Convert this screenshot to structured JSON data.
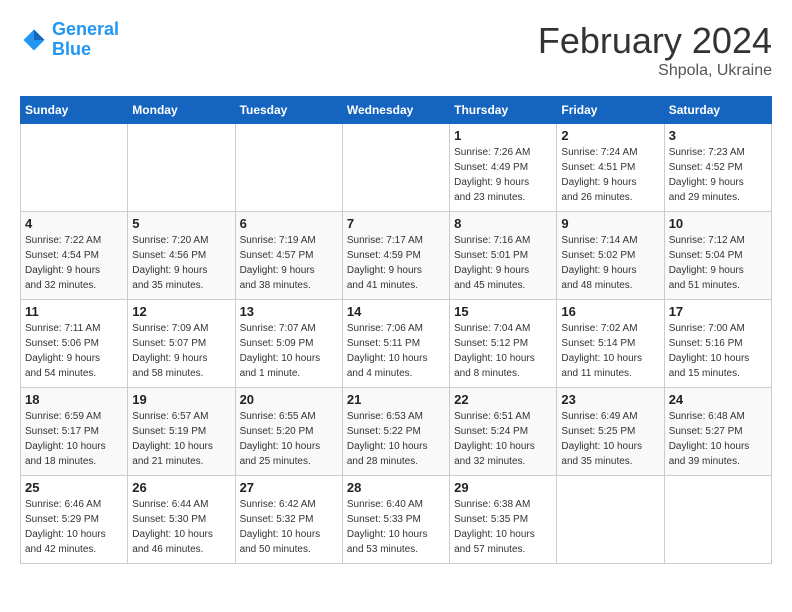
{
  "header": {
    "logo_line1": "General",
    "logo_line2": "Blue",
    "month_year": "February 2024",
    "location": "Shpola, Ukraine"
  },
  "days_of_week": [
    "Sunday",
    "Monday",
    "Tuesday",
    "Wednesday",
    "Thursday",
    "Friday",
    "Saturday"
  ],
  "weeks": [
    [
      {
        "day": "",
        "info": ""
      },
      {
        "day": "",
        "info": ""
      },
      {
        "day": "",
        "info": ""
      },
      {
        "day": "",
        "info": ""
      },
      {
        "day": "1",
        "info": "Sunrise: 7:26 AM\nSunset: 4:49 PM\nDaylight: 9 hours\nand 23 minutes."
      },
      {
        "day": "2",
        "info": "Sunrise: 7:24 AM\nSunset: 4:51 PM\nDaylight: 9 hours\nand 26 minutes."
      },
      {
        "day": "3",
        "info": "Sunrise: 7:23 AM\nSunset: 4:52 PM\nDaylight: 9 hours\nand 29 minutes."
      }
    ],
    [
      {
        "day": "4",
        "info": "Sunrise: 7:22 AM\nSunset: 4:54 PM\nDaylight: 9 hours\nand 32 minutes."
      },
      {
        "day": "5",
        "info": "Sunrise: 7:20 AM\nSunset: 4:56 PM\nDaylight: 9 hours\nand 35 minutes."
      },
      {
        "day": "6",
        "info": "Sunrise: 7:19 AM\nSunset: 4:57 PM\nDaylight: 9 hours\nand 38 minutes."
      },
      {
        "day": "7",
        "info": "Sunrise: 7:17 AM\nSunset: 4:59 PM\nDaylight: 9 hours\nand 41 minutes."
      },
      {
        "day": "8",
        "info": "Sunrise: 7:16 AM\nSunset: 5:01 PM\nDaylight: 9 hours\nand 45 minutes."
      },
      {
        "day": "9",
        "info": "Sunrise: 7:14 AM\nSunset: 5:02 PM\nDaylight: 9 hours\nand 48 minutes."
      },
      {
        "day": "10",
        "info": "Sunrise: 7:12 AM\nSunset: 5:04 PM\nDaylight: 9 hours\nand 51 minutes."
      }
    ],
    [
      {
        "day": "11",
        "info": "Sunrise: 7:11 AM\nSunset: 5:06 PM\nDaylight: 9 hours\nand 54 minutes."
      },
      {
        "day": "12",
        "info": "Sunrise: 7:09 AM\nSunset: 5:07 PM\nDaylight: 9 hours\nand 58 minutes."
      },
      {
        "day": "13",
        "info": "Sunrise: 7:07 AM\nSunset: 5:09 PM\nDaylight: 10 hours\nand 1 minute."
      },
      {
        "day": "14",
        "info": "Sunrise: 7:06 AM\nSunset: 5:11 PM\nDaylight: 10 hours\nand 4 minutes."
      },
      {
        "day": "15",
        "info": "Sunrise: 7:04 AM\nSunset: 5:12 PM\nDaylight: 10 hours\nand 8 minutes."
      },
      {
        "day": "16",
        "info": "Sunrise: 7:02 AM\nSunset: 5:14 PM\nDaylight: 10 hours\nand 11 minutes."
      },
      {
        "day": "17",
        "info": "Sunrise: 7:00 AM\nSunset: 5:16 PM\nDaylight: 10 hours\nand 15 minutes."
      }
    ],
    [
      {
        "day": "18",
        "info": "Sunrise: 6:59 AM\nSunset: 5:17 PM\nDaylight: 10 hours\nand 18 minutes."
      },
      {
        "day": "19",
        "info": "Sunrise: 6:57 AM\nSunset: 5:19 PM\nDaylight: 10 hours\nand 21 minutes."
      },
      {
        "day": "20",
        "info": "Sunrise: 6:55 AM\nSunset: 5:20 PM\nDaylight: 10 hours\nand 25 minutes."
      },
      {
        "day": "21",
        "info": "Sunrise: 6:53 AM\nSunset: 5:22 PM\nDaylight: 10 hours\nand 28 minutes."
      },
      {
        "day": "22",
        "info": "Sunrise: 6:51 AM\nSunset: 5:24 PM\nDaylight: 10 hours\nand 32 minutes."
      },
      {
        "day": "23",
        "info": "Sunrise: 6:49 AM\nSunset: 5:25 PM\nDaylight: 10 hours\nand 35 minutes."
      },
      {
        "day": "24",
        "info": "Sunrise: 6:48 AM\nSunset: 5:27 PM\nDaylight: 10 hours\nand 39 minutes."
      }
    ],
    [
      {
        "day": "25",
        "info": "Sunrise: 6:46 AM\nSunset: 5:29 PM\nDaylight: 10 hours\nand 42 minutes."
      },
      {
        "day": "26",
        "info": "Sunrise: 6:44 AM\nSunset: 5:30 PM\nDaylight: 10 hours\nand 46 minutes."
      },
      {
        "day": "27",
        "info": "Sunrise: 6:42 AM\nSunset: 5:32 PM\nDaylight: 10 hours\nand 50 minutes."
      },
      {
        "day": "28",
        "info": "Sunrise: 6:40 AM\nSunset: 5:33 PM\nDaylight: 10 hours\nand 53 minutes."
      },
      {
        "day": "29",
        "info": "Sunrise: 6:38 AM\nSunset: 5:35 PM\nDaylight: 10 hours\nand 57 minutes."
      },
      {
        "day": "",
        "info": ""
      },
      {
        "day": "",
        "info": ""
      }
    ]
  ]
}
